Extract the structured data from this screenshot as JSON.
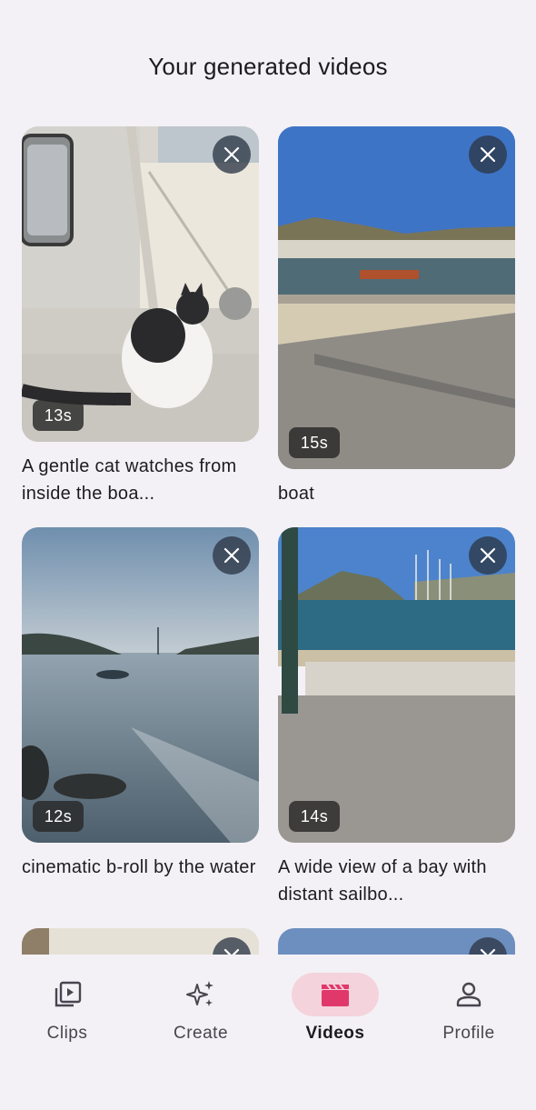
{
  "header": {
    "title": "Your generated videos"
  },
  "videos": [
    {
      "caption": "A gentle cat watches from inside the boa...",
      "duration": "13s"
    },
    {
      "caption": "boat",
      "duration": "15s"
    },
    {
      "caption": "cinematic b-roll by the water",
      "duration": "12s"
    },
    {
      "caption": "A wide view of a bay with distant sailbo...",
      "duration": "14s"
    }
  ],
  "icons": {
    "close": "close-icon",
    "clips": "play-library-icon",
    "create": "sparkles-icon",
    "videos": "clapperboard-icon",
    "profile": "person-icon"
  },
  "nav": {
    "items": [
      {
        "label": "Clips"
      },
      {
        "label": "Create"
      },
      {
        "label": "Videos"
      },
      {
        "label": "Profile"
      }
    ],
    "active": "Videos"
  },
  "colors": {
    "background": "#f3f1f6",
    "active_indicator": "#f4d3dc",
    "accent": "#e0386a"
  }
}
